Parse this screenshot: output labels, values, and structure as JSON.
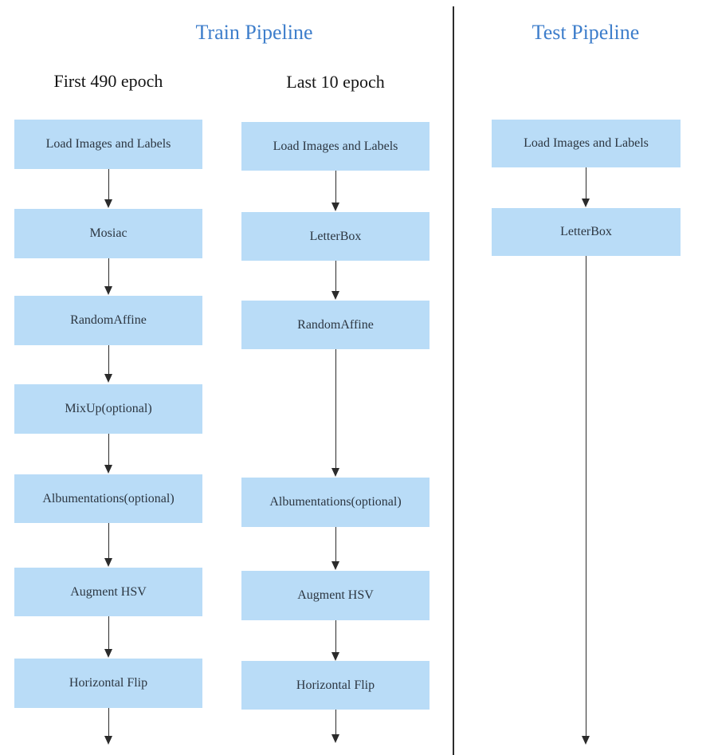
{
  "diagram": {
    "title_train": "Train Pipeline",
    "title_test": "Test Pipeline",
    "colors": {
      "box_fill": "#b9dcf7",
      "box_text": "#2c3641",
      "heading": "#3e7ecb",
      "subtitle": "#151515",
      "arrow": "#2b2b2b",
      "divider": "#2c2c2c",
      "background": "#ffffff"
    },
    "columns": [
      {
        "id": "train-first-490",
        "subtitle": "First 490 epoch",
        "steps": [
          "Load Images and Labels",
          "Mosiac",
          "RandomAffine",
          "MixUp(optional)",
          "Albumentations(optional)",
          "Augment HSV",
          "Horizontal Flip"
        ],
        "trailing_arrow": true
      },
      {
        "id": "train-last-10",
        "subtitle": "Last 10 epoch",
        "steps": [
          "Load Images and Labels",
          "LetterBox",
          "RandomAffine",
          "Albumentations(optional)",
          "Augment HSV",
          "Horizontal Flip"
        ],
        "trailing_arrow": true
      },
      {
        "id": "test",
        "subtitle": "",
        "steps": [
          "Load Images and Labels",
          "LetterBox"
        ],
        "trailing_arrow": true
      }
    ]
  }
}
